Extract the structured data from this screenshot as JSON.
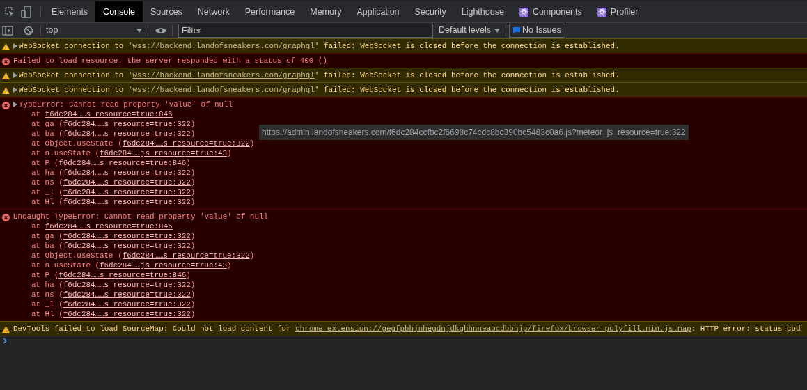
{
  "tabs": [
    {
      "label": "Elements",
      "selected": false,
      "icon": false
    },
    {
      "label": "Console",
      "selected": true,
      "icon": false
    },
    {
      "label": "Sources",
      "selected": false,
      "icon": false
    },
    {
      "label": "Network",
      "selected": false,
      "icon": false
    },
    {
      "label": "Performance",
      "selected": false,
      "icon": false
    },
    {
      "label": "Memory",
      "selected": false,
      "icon": false
    },
    {
      "label": "Application",
      "selected": false,
      "icon": false
    },
    {
      "label": "Security",
      "selected": false,
      "icon": false
    },
    {
      "label": "Lighthouse",
      "selected": false,
      "icon": false
    },
    {
      "label": "Components",
      "selected": false,
      "icon": true
    },
    {
      "label": "Profiler",
      "selected": false,
      "icon": true
    }
  ],
  "toolbar": {
    "context": "top",
    "filter": {
      "placeholder": "Filter"
    },
    "levels": "Default levels",
    "issues": "No Issues"
  },
  "messages": [
    {
      "kind": "warning",
      "expandable": true,
      "before": "WebSocket connection to '",
      "link": "wss://backend.landofsneakers.com/graphql",
      "after": "' failed: WebSocket is closed before the connection is established."
    },
    {
      "kind": "error",
      "expandable": false,
      "before": "Failed to load resource: the server responded with a status of 400 ()"
    },
    {
      "kind": "warning",
      "expandable": true,
      "before": "WebSocket connection to '",
      "link": "wss://backend.landofsneakers.com/graphql",
      "after": "' failed: WebSocket is closed before the connection is established."
    },
    {
      "kind": "warning",
      "expandable": true,
      "before": "WebSocket connection to '",
      "link": "wss://backend.landofsneakers.com/graphql",
      "after": "' failed: WebSocket is closed before the connection is established."
    },
    {
      "kind": "error",
      "expandable": true,
      "before": "TypeError: Cannot read property 'value' of null",
      "stack": [
        {
          "before": "at ",
          "link": "f6dc284……s resource=true:846"
        },
        {
          "before": "at ga (",
          "link": "f6dc284……s resource=true:322",
          "after": ")"
        },
        {
          "before": "at ba (",
          "link": "f6dc284……s resource=true:322",
          "after": ")"
        },
        {
          "before": "at Object.useState (",
          "link": "f6dc284……s resource=true:322",
          "after": ")"
        },
        {
          "before": "at n.useState (",
          "link": "f6dc284……js resource=true:43",
          "after": ")"
        },
        {
          "before": "at P (",
          "link": "f6dc284……s resource=true:846",
          "after": ")"
        },
        {
          "before": "at ha (",
          "link": "f6dc284……s resource=true:322",
          "after": ")"
        },
        {
          "before": "at ns (",
          "link": "f6dc284……s resource=true:322",
          "after": ")"
        },
        {
          "before": "at _l (",
          "link": "f6dc284……s resource=true:322",
          "after": ")"
        },
        {
          "before": "at Hl (",
          "link": "f6dc284……s resource=true:322",
          "after": ")"
        }
      ]
    },
    {
      "kind": "error",
      "expandable": false,
      "before": "Uncaught TypeError: Cannot read property 'value' of null",
      "stack": [
        {
          "before": "at ",
          "link": "f6dc284……s resource=true:846"
        },
        {
          "before": "at ga (",
          "link": "f6dc284……s resource=true:322",
          "after": ")"
        },
        {
          "before": "at ba (",
          "link": "f6dc284……s resource=true:322",
          "after": ")"
        },
        {
          "before": "at Object.useState (",
          "link": "f6dc284……s resource=true:322",
          "after": ")"
        },
        {
          "before": "at n.useState (",
          "link": "f6dc284……js resource=true:43",
          "after": ")"
        },
        {
          "before": "at P (",
          "link": "f6dc284……s resource=true:846",
          "after": ")"
        },
        {
          "before": "at ha (",
          "link": "f6dc284……s resource=true:322",
          "after": ")"
        },
        {
          "before": "at ns (",
          "link": "f6dc284……s resource=true:322",
          "after": ")"
        },
        {
          "before": "at _l (",
          "link": "f6dc284……s resource=true:322",
          "after": ")"
        },
        {
          "before": "at Hl (",
          "link": "f6dc284……s resource=true:322",
          "after": ")"
        }
      ]
    },
    {
      "kind": "warning",
      "expandable": false,
      "before": "DevTools failed to load SourceMap: Could not load content for ",
      "link": "chrome-extension://gegfpbhjnhegdnjdkghhnneaocdbbhjp/firefox/browser-polyfill.min.js.map",
      "after": ": HTTP error: status cod"
    }
  ],
  "tooltip": "https://admin.landofsneakers.com/f6dc284ccfbc2f6698c74cdc8bc390bc5483c0a6.js?meteor_js_resource=true:322"
}
